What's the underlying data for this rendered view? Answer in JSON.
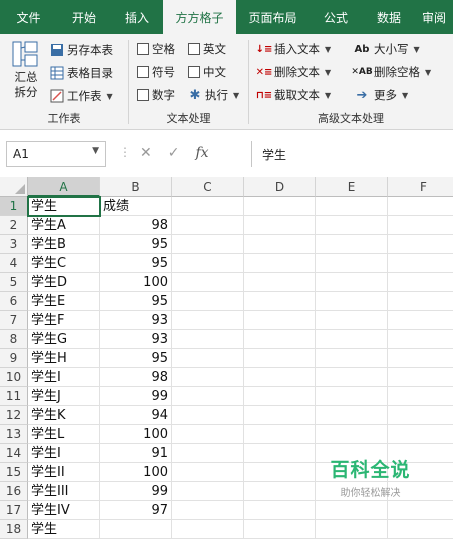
{
  "tabs": [
    "文件",
    "开始",
    "插入",
    "方方格子",
    "页面布局",
    "公式",
    "数据",
    "审阅"
  ],
  "ribbon": {
    "workbook_group": {
      "label": "工作表",
      "summary_split": "汇总拆分",
      "save_copy": "另存本表",
      "sheet_index": "表格目录",
      "worksheet": "工作表"
    },
    "text_group": {
      "label": "文本处理",
      "checks": [
        "空格",
        "英文",
        "符号",
        "中文",
        "数字"
      ],
      "execute": "执行"
    },
    "advanced_group": {
      "label": "高级文本处理",
      "insert_text": "插入文本",
      "delete_text": "删除文本",
      "extract_text": "截取文本",
      "case": "大小写",
      "delete_spaces": "删除空格",
      "more": "更多"
    }
  },
  "formula_bar": {
    "name_box": "A1",
    "fx": "fx",
    "formula": "学生"
  },
  "columns": [
    "A",
    "B",
    "C",
    "D",
    "E",
    "F"
  ],
  "rows": [
    {
      "n": "1",
      "a": "学生",
      "b": "成绩"
    },
    {
      "n": "2",
      "a": "学生A",
      "b": "98"
    },
    {
      "n": "3",
      "a": "学生B",
      "b": "95"
    },
    {
      "n": "4",
      "a": "学生C",
      "b": "95"
    },
    {
      "n": "5",
      "a": "学生D",
      "b": "100"
    },
    {
      "n": "6",
      "a": "学生E",
      "b": "95"
    },
    {
      "n": "7",
      "a": "学生F",
      "b": "93"
    },
    {
      "n": "8",
      "a": "学生G",
      "b": "93"
    },
    {
      "n": "9",
      "a": "学生H",
      "b": "95"
    },
    {
      "n": "10",
      "a": "学生I",
      "b": "98"
    },
    {
      "n": "11",
      "a": "学生J",
      "b": "99"
    },
    {
      "n": "12",
      "a": "学生K",
      "b": "94"
    },
    {
      "n": "13",
      "a": "学生L",
      "b": "100"
    },
    {
      "n": "14",
      "a": "学生I",
      "b": "91"
    },
    {
      "n": "15",
      "a": "学生II",
      "b": "100"
    },
    {
      "n": "16",
      "a": "学生III",
      "b": "99"
    },
    {
      "n": "17",
      "a": "学生IV",
      "b": "97"
    },
    {
      "n": "18",
      "a": "学生",
      "b": ""
    }
  ],
  "watermark": {
    "title": "百科全说",
    "subtitle": "助你轻松解决"
  },
  "colors": {
    "excel_green": "#217346",
    "watermark_green": "#2bb673"
  }
}
